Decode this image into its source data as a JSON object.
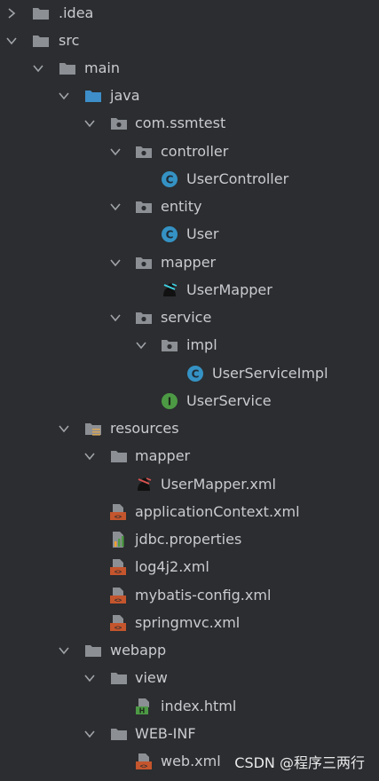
{
  "tree": {
    "rows": [
      {
        "label": ".idea",
        "icon": "folder-icon",
        "expanded": false
      },
      {
        "label": "src",
        "icon": "folder-icon",
        "expanded": true
      },
      {
        "label": "main",
        "icon": "folder-icon",
        "expanded": true
      },
      {
        "label": "java",
        "icon": "source-folder-icon",
        "expanded": true
      },
      {
        "label": "com.ssmtest",
        "icon": "package-icon",
        "expanded": true
      },
      {
        "label": "controller",
        "icon": "package-icon",
        "expanded": true
      },
      {
        "label": "UserController",
        "icon": "class-icon"
      },
      {
        "label": "entity",
        "icon": "package-icon",
        "expanded": true
      },
      {
        "label": "User",
        "icon": "class-icon"
      },
      {
        "label": "mapper",
        "icon": "package-icon",
        "expanded": true
      },
      {
        "label": "UserMapper",
        "icon": "mybatis-mapper-icon"
      },
      {
        "label": "service",
        "icon": "package-icon",
        "expanded": true
      },
      {
        "label": "impl",
        "icon": "package-icon",
        "expanded": true
      },
      {
        "label": "UserServiceImpl",
        "icon": "class-icon"
      },
      {
        "label": "UserService",
        "icon": "interface-icon"
      },
      {
        "label": "resources",
        "icon": "resources-folder-icon",
        "expanded": true
      },
      {
        "label": "mapper",
        "icon": "folder-icon",
        "expanded": true
      },
      {
        "label": "UserMapper.xml",
        "icon": "mybatis-xml-icon"
      },
      {
        "label": "applicationContext.xml",
        "icon": "xml-icon"
      },
      {
        "label": "jdbc.properties",
        "icon": "properties-icon"
      },
      {
        "label": "log4j2.xml",
        "icon": "xml-icon"
      },
      {
        "label": "mybatis-config.xml",
        "icon": "xml-icon"
      },
      {
        "label": "springmvc.xml",
        "icon": "xml-icon"
      },
      {
        "label": "webapp",
        "icon": "folder-icon",
        "expanded": true
      },
      {
        "label": "view",
        "icon": "folder-icon",
        "expanded": true
      },
      {
        "label": "index.html",
        "icon": "html-icon"
      },
      {
        "label": "WEB-INF",
        "icon": "folder-icon",
        "expanded": true
      },
      {
        "label": "web.xml",
        "icon": "xml-icon"
      }
    ]
  },
  "watermark": "CSDN @程序三两行",
  "colors": {
    "background": "#2b2d30",
    "text": "#c9cbd0",
    "folder": "#8c8f94",
    "source_folder": "#3d8ec9",
    "class": "#3592c4",
    "interface": "#4d9a45",
    "xml": "#c4552d",
    "chevron": "#a0a3a8"
  }
}
